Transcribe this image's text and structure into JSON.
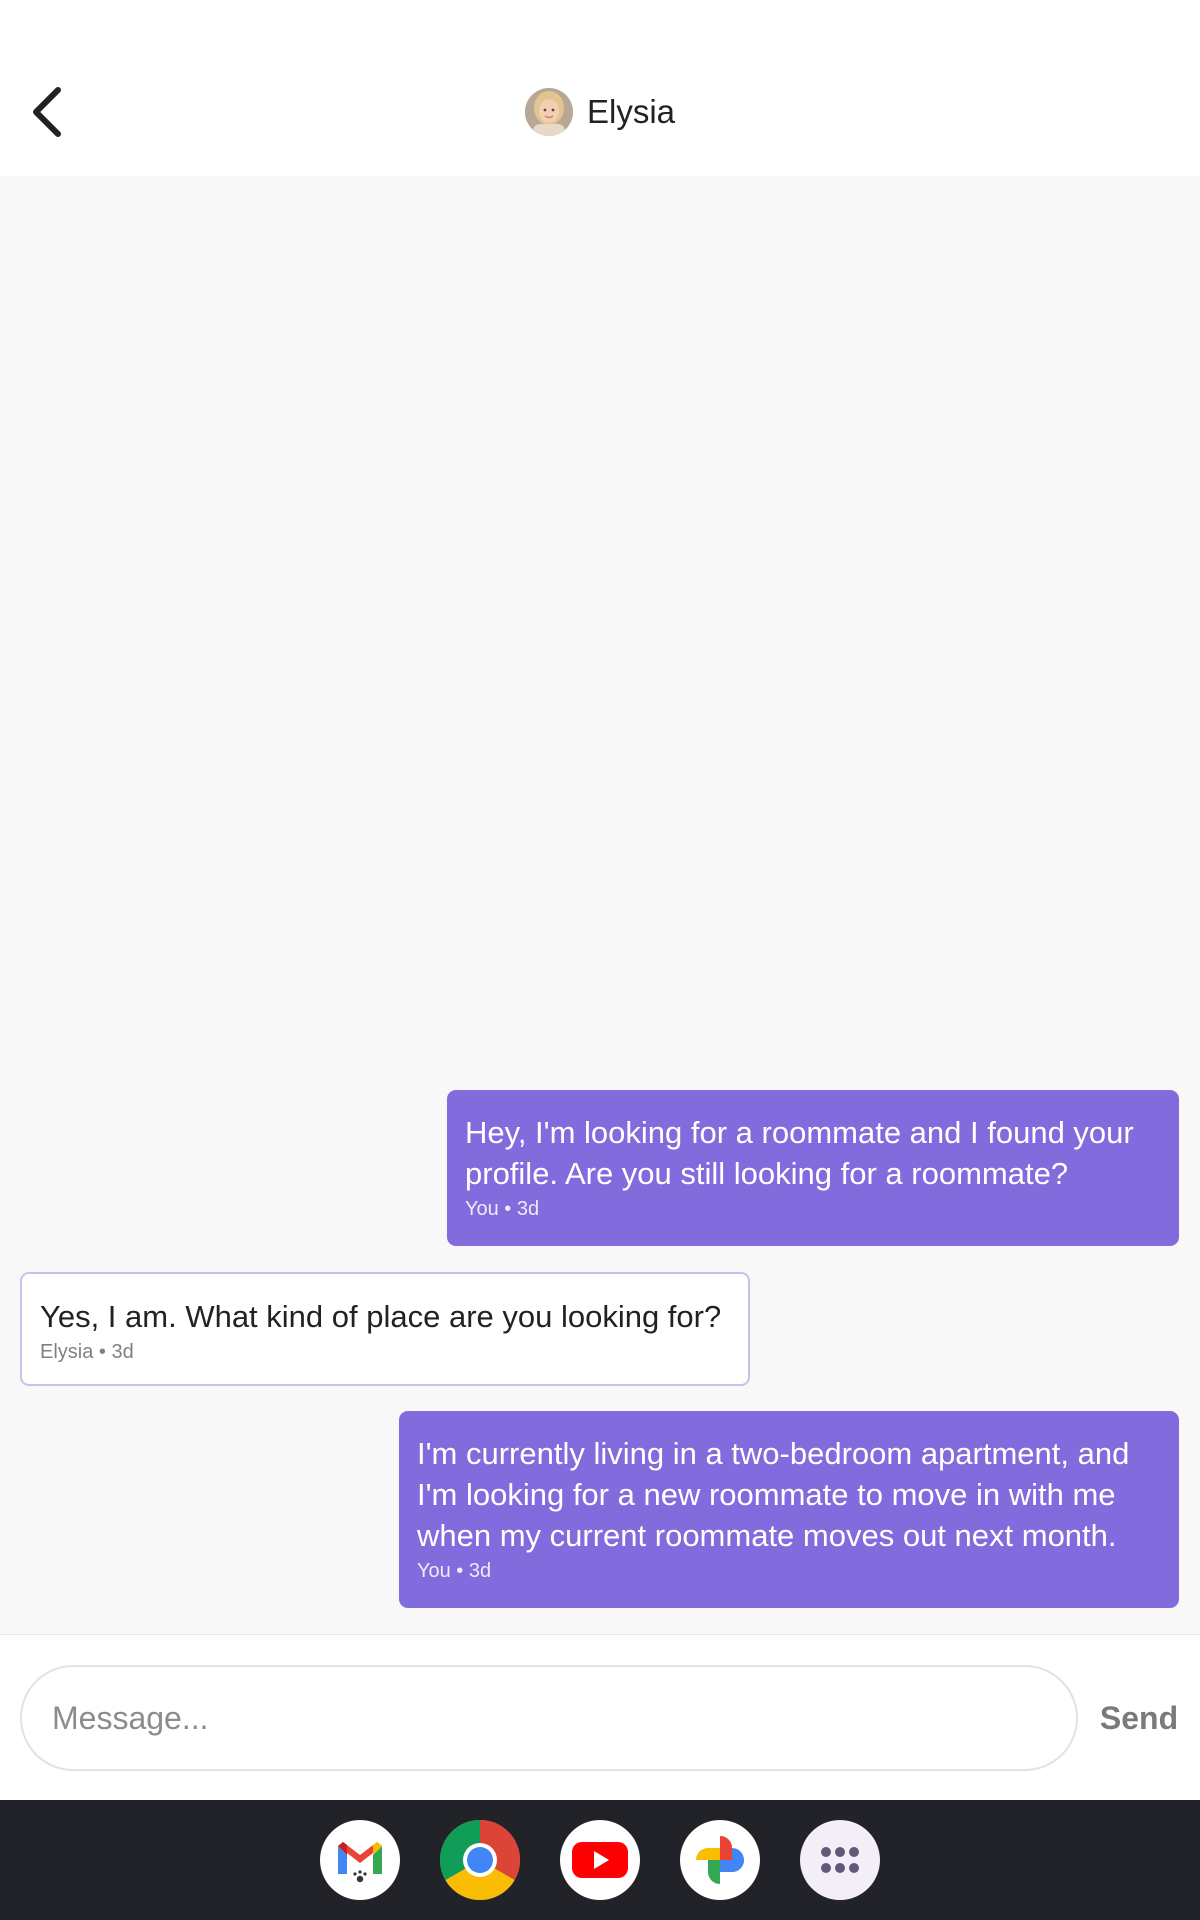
{
  "header": {
    "contact_name": "Elysia",
    "back_icon": "chevron-left-icon",
    "avatar_icon": "contact-avatar"
  },
  "messages": [
    {
      "direction": "outgoing",
      "text": "Hey, I'm looking for a roommate and I found your profile. Are you still looking for a roommate?",
      "meta": "You • 3d"
    },
    {
      "direction": "incoming",
      "text": "Yes, I am. What kind of place are you looking for?",
      "meta": "Elysia  • 3d"
    },
    {
      "direction": "outgoing",
      "text": "I'm currently living in a two-bedroom apartment, and I'm looking for a new roommate to move in with me when my current roommate moves out next month.",
      "meta": "You • 3d"
    }
  ],
  "composer": {
    "placeholder": "Message...",
    "value": "",
    "send_label": "Send"
  },
  "taskbar": {
    "apps": [
      "gmail-icon",
      "chrome-icon",
      "youtube-icon",
      "photos-icon",
      "app-drawer-icon"
    ]
  },
  "colors": {
    "outgoing_bubble": "#826bdc",
    "incoming_border": "#c9c0ec",
    "background": "#f8f8f8",
    "taskbar": "#222229"
  }
}
